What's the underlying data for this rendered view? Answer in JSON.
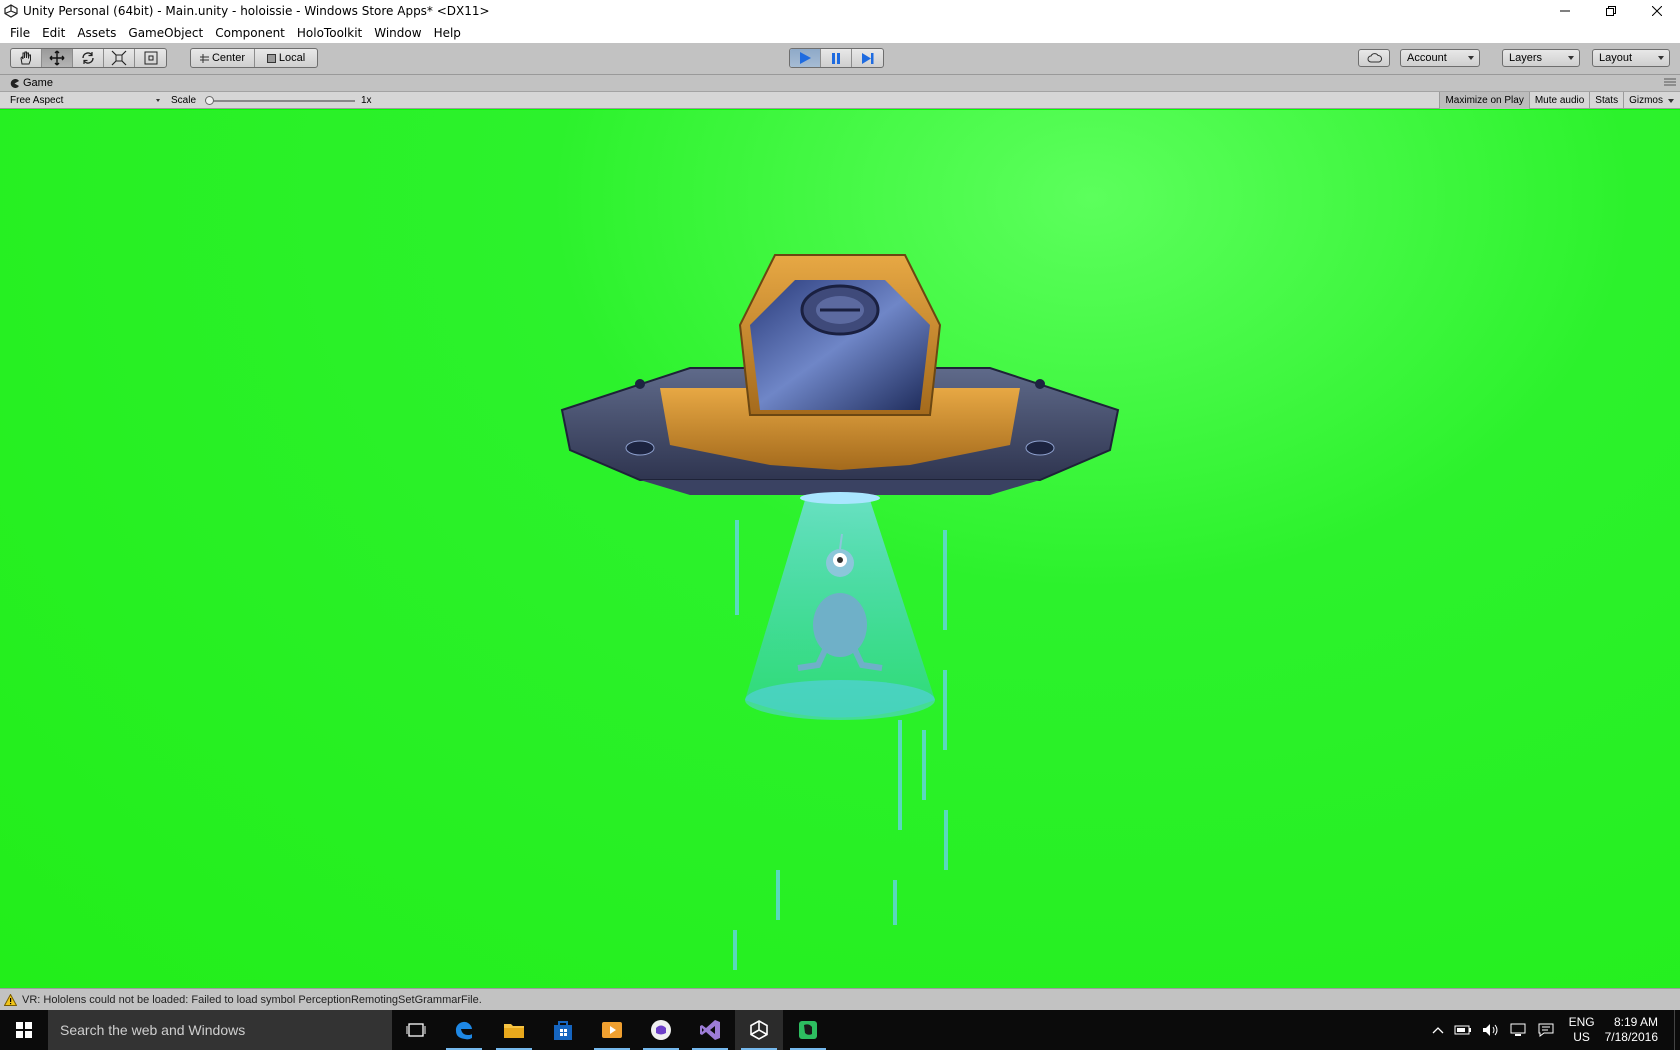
{
  "window": {
    "title": "Unity Personal (64bit) - Main.unity - holoissie - Windows Store Apps* <DX11>",
    "controls": [
      "minimize-icon",
      "restore-icon",
      "close-icon"
    ]
  },
  "menu": [
    "File",
    "Edit",
    "Assets",
    "GameObject",
    "Component",
    "HoloToolkit",
    "Window",
    "Help"
  ],
  "toolbar": {
    "tools": [
      "hand-tool-icon",
      "move-tool-icon",
      "rotate-tool-icon",
      "scale-tool-icon",
      "rect-tool-icon"
    ],
    "active_tool": "move-tool-icon",
    "pivot": "Center",
    "space": "Local",
    "playback": [
      "play-icon",
      "pause-icon",
      "step-icon"
    ],
    "play_state": "playing",
    "account": "Account",
    "layers": "Layers",
    "layout": "Layout"
  },
  "game_view": {
    "tab": "Game",
    "aspect": "Free Aspect",
    "scale_label": "Scale",
    "scale_value": "1x",
    "scale_fraction": 0,
    "buttons": [
      "Maximize on Play",
      "Mute audio",
      "Stats",
      "Gizmos"
    ],
    "background_color": "#22ee1a"
  },
  "status": {
    "message": "VR: Hololens could not be loaded: Failed to load symbol PerceptionRemotingSetGrammarFile."
  },
  "taskbar": {
    "search_placeholder": "Search the web and Windows",
    "apps": [
      "task-view-icon",
      "edge-icon",
      "file-explorer-icon",
      "store-icon",
      "media-player-icon",
      "github-icon",
      "visual-studio-icon",
      "unity-icon",
      "evernote-icon"
    ],
    "language": "ENG",
    "region": "US",
    "time": "8:19 AM",
    "date": "7/18/2016"
  }
}
